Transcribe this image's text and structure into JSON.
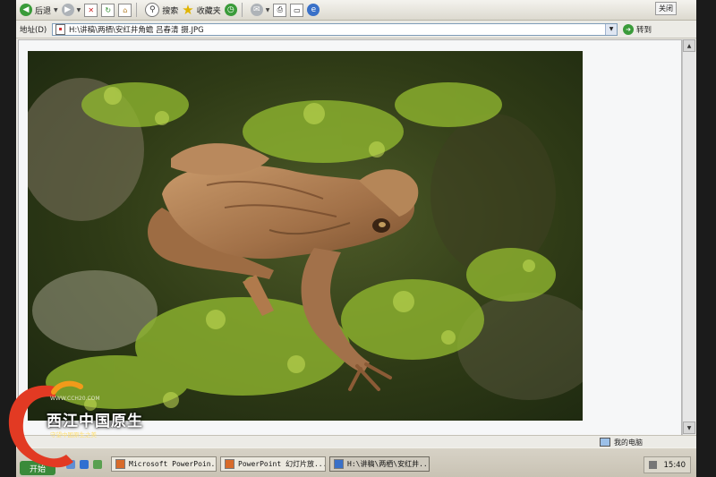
{
  "toolbar": {
    "back_label": "后退",
    "search_label": "搜索",
    "favorites_label": "收藏夹",
    "close_label": "关闭"
  },
  "addressbar": {
    "label": "地址(D)",
    "path": "H:\\讲稿\\两栖\\安红井角蟾 吕春清 摄.JPG",
    "go_label": "转到"
  },
  "statusbar": {
    "zone": "我的电脑"
  },
  "taskbar": {
    "start_label": "开始",
    "tasks": [
      "Microsoft PowerPoin...",
      "PowerPoint 幻灯片放...",
      "H:\\讲稿\\两栖\\安红井..."
    ],
    "clock": "15:40"
  },
  "watermark": {
    "title": "西江中国原生",
    "url": "WWW.CCH20.COM",
    "tagline": "守望中国原生之美"
  },
  "colors": {
    "screen_bg": "#e9e7e2",
    "frame": "#1b1b1b",
    "accent": "#3a9b3a"
  }
}
